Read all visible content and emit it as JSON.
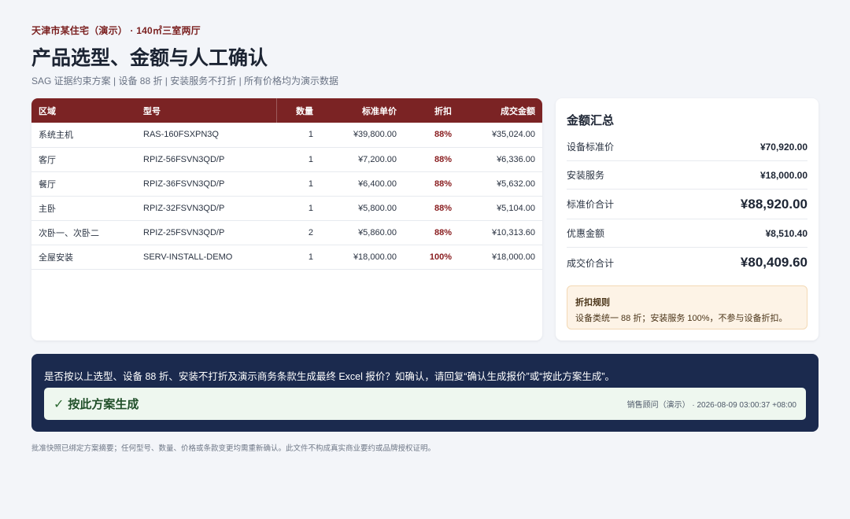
{
  "header": {
    "eyebrow": "天津市某住宅（演示） · 140㎡三室两厅",
    "title": "产品选型、金额与人工确认",
    "subtitle": "SAG 证据约束方案 | 设备 88 折 | 安装服务不打折 | 所有价格均为演示数据"
  },
  "table": {
    "columns": [
      "区域",
      "型号",
      "数量",
      "标准单价",
      "折扣",
      "成交金额"
    ],
    "rows": [
      {
        "region": "系统主机",
        "model": "RAS-160FSXPN3Q",
        "qty": "1",
        "price": "¥39,800.00",
        "discount": "88%",
        "amount": "¥35,024.00"
      },
      {
        "region": "客厅",
        "model": "RPIZ-56FSVN3QD/P",
        "qty": "1",
        "price": "¥7,200.00",
        "discount": "88%",
        "amount": "¥6,336.00"
      },
      {
        "region": "餐厅",
        "model": "RPIZ-36FSVN3QD/P",
        "qty": "1",
        "price": "¥6,400.00",
        "discount": "88%",
        "amount": "¥5,632.00"
      },
      {
        "region": "主卧",
        "model": "RPIZ-32FSVN3QD/P",
        "qty": "1",
        "price": "¥5,800.00",
        "discount": "88%",
        "amount": "¥5,104.00"
      },
      {
        "region": "次卧一、次卧二",
        "model": "RPIZ-25FSVN3QD/P",
        "qty": "2",
        "price": "¥5,860.00",
        "discount": "88%",
        "amount": "¥10,313.60"
      },
      {
        "region": "全屋安装",
        "model": "SERV-INSTALL-DEMO",
        "qty": "1",
        "price": "¥18,000.00",
        "discount": "100%",
        "amount": "¥18,000.00"
      }
    ]
  },
  "summary": {
    "title": "金额汇总",
    "rows": [
      {
        "label": "设备标准价",
        "value": "¥70,920.00"
      },
      {
        "label": "安装服务",
        "value": "¥18,000.00"
      },
      {
        "label": "标准价合计",
        "value": "¥88,920.00"
      },
      {
        "label": "优惠金额",
        "value": "¥8,510.40"
      },
      {
        "label": "成交价合计",
        "value": "¥80,409.60"
      }
    ],
    "rule_title": "折扣规则",
    "rule_text": "设备类统一 88 折；安装服务 100%，不参与设备折扣。"
  },
  "confirm": {
    "question": "是否按以上选型、设备 88 折、安装不打折及演示商务条款生成最终 Excel 报价？如确认，请回复“确认生成报价”或“按此方案生成”。",
    "reply_icon": "✓",
    "reply_text": "按此方案生成",
    "reply_meta": "销售顾问（演示） · 2026-08-09 03:00:37 +08:00"
  },
  "footnote": "批准快照已绑定方案摘要；任何型号、数量、价格或条款变更均需重新确认。此文件不构成真实商业要约或品牌授权证明。"
}
